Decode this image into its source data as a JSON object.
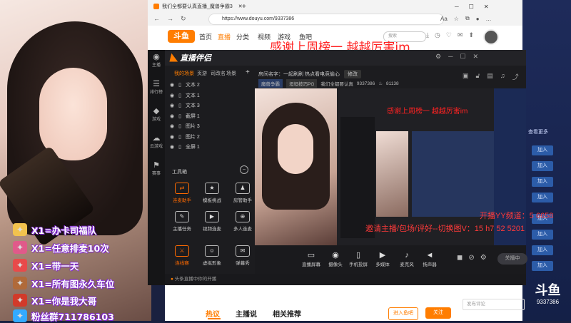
{
  "camera": {
    "gifts": [
      {
        "text": "X1=办卡司福队",
        "icon_color": "#f2c24e"
      },
      {
        "text": "X1=任意排麦10次",
        "icon_color": "#e05a8a"
      },
      {
        "text": "X1=带一天",
        "icon_color": "#e84a4a"
      },
      {
        "text": "X1=所有图永久车位",
        "icon_color": "#b06a3a"
      },
      {
        "text": "X1=你是我大哥",
        "icon_color": "#d23a2a"
      },
      {
        "text": "粉丝群711786103",
        "icon_color": "#33aaff"
      }
    ]
  },
  "browser": {
    "tab_title": "我们全都要认真直播_魔兽争霸3",
    "url": "https://www.douyu.com/9337386",
    "nav": [
      "首页",
      "直播",
      "分类",
      "视频",
      "游戏",
      "鱼吧"
    ],
    "overlay_title": "感谢上周榜一 越越厉害im"
  },
  "app": {
    "brand": "直播伴侣",
    "sidebar": [
      {
        "icon": "broadcast-icon",
        "glyph": "◉",
        "label": "主播"
      },
      {
        "icon": "rank-icon",
        "glyph": "☰",
        "label": "排行榜"
      },
      {
        "icon": "game-icon",
        "glyph": "◆",
        "label": "游戏"
      },
      {
        "icon": "cloud-game-icon",
        "glyph": "☁",
        "label": "云游戏"
      },
      {
        "icon": "activity-icon",
        "glyph": "⚑",
        "label": "赛事"
      }
    ],
    "scene_tabs": [
      "我的场景",
      "页游",
      "司改名",
      "场景"
    ],
    "sources": [
      "文本 2",
      "文本 1",
      "文本 3",
      "截屏 1",
      "图片 3",
      "图片 2",
      "全屏 1"
    ],
    "toolbox_title": "工具箱",
    "tools": [
      {
        "label": "连麦助手",
        "icon": "mic-link-icon",
        "glyph": "⇄",
        "hot": true
      },
      {
        "label": "模板挑战",
        "icon": "template-icon",
        "glyph": "★",
        "hot": false
      },
      {
        "label": "房管助手",
        "icon": "admin-icon",
        "glyph": "♟",
        "hot": false
      },
      {
        "label": "主播任务",
        "icon": "task-icon",
        "glyph": "✎",
        "hot": false
      },
      {
        "label": "视频连麦",
        "icon": "video-link-icon",
        "glyph": "▶",
        "hot": false
      },
      {
        "label": "多人连麦",
        "icon": "multi-link-icon",
        "glyph": "⊕",
        "hot": false
      },
      {
        "label": "连线赛",
        "icon": "match-icon",
        "glyph": "⚔",
        "hot": true
      },
      {
        "label": "虚拟形象",
        "icon": "avatar-icon",
        "glyph": "☺",
        "hot": false
      },
      {
        "label": "弹幕秀",
        "icon": "danmu-icon",
        "glyph": "✉",
        "hot": false
      }
    ],
    "room_title": "房间名字：一起刷刷 热点看电竞偷心",
    "modify_label": "修改",
    "category": "魔兽争霸",
    "category2": "坦坦技巧PG",
    "room_name": "我们全都要认真",
    "room_id": "9337386",
    "viewers": "81138",
    "bottom_tools": [
      {
        "label": "直播屏幕",
        "icon": "screen-icon",
        "glyph": "▭"
      },
      {
        "label": "摄像头",
        "icon": "camera-icon",
        "glyph": "◉"
      },
      {
        "label": "手机投屏",
        "icon": "phone-icon",
        "glyph": "▯"
      },
      {
        "label": "多媒体",
        "icon": "media-icon",
        "glyph": "▶"
      },
      {
        "label": "麦克风",
        "icon": "mic-icon",
        "glyph": "♪"
      },
      {
        "label": "扬声器",
        "icon": "speaker-icon",
        "glyph": "◄"
      }
    ],
    "start_button": "关播中",
    "footer": "头条直播中你的开播"
  },
  "page": {
    "tabs": [
      "热议",
      "主播说",
      "相关推荐"
    ],
    "join_label": "进入鱼吧",
    "follow_label": "关注",
    "comment_placeholder": "发布评论"
  },
  "right_panel": {
    "buttons": [
      "加入",
      "加入",
      "加入",
      "加入",
      "加入",
      "加入",
      "加入",
      "加入"
    ],
    "label_more": "查看更多",
    "marquee_1": "开播YY频道：5 6658",
    "marquee_2": "邀请主播/包场/评好--切换图V：15 h7 52 5201"
  },
  "logo": {
    "text": "斗鱼",
    "room": "9337386"
  },
  "colors": {
    "accent": "#ff6a00",
    "overlay_red": "#ff2222",
    "brand_orange": "#ff7d00"
  }
}
